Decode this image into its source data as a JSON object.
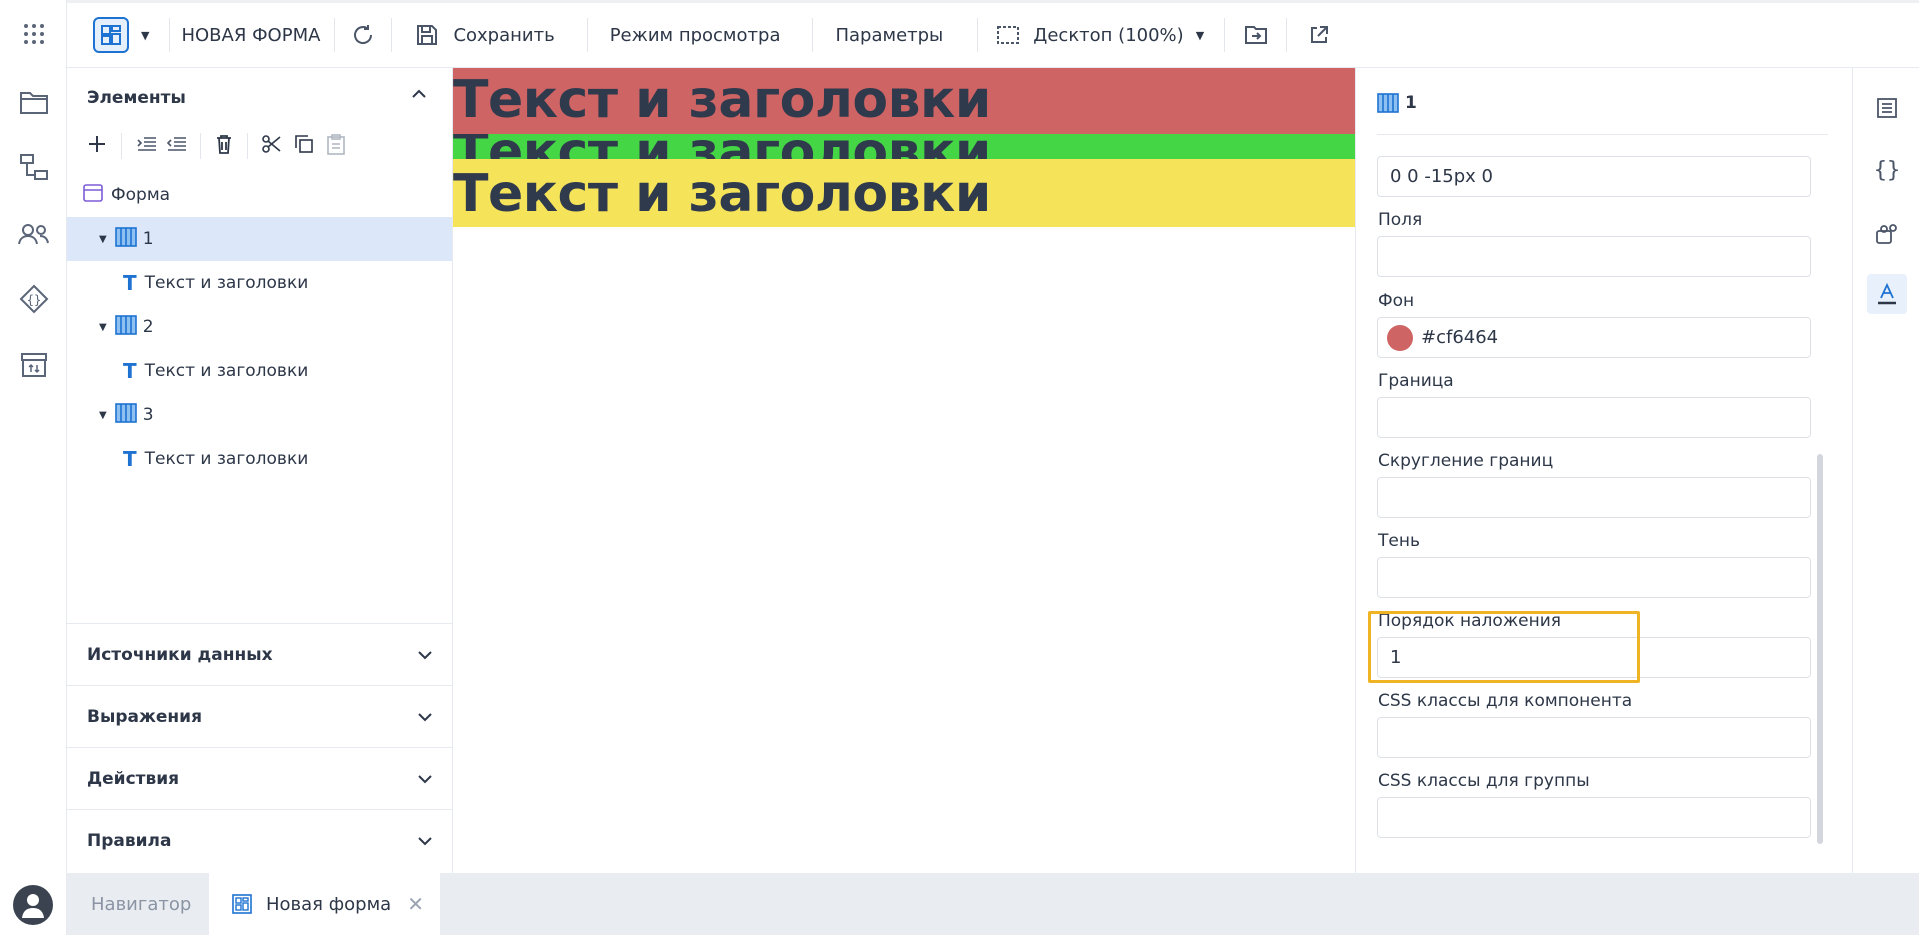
{
  "topbar": {
    "form_title": "НОВАЯ ФОРМА",
    "save_label": "Сохранить",
    "preview_label": "Режим просмотра",
    "params_label": "Параметры",
    "device_label": "Десктоп (100%)"
  },
  "left_panel": {
    "elements_title": "Элементы",
    "tree": [
      {
        "label": "Форма",
        "type": "form"
      },
      {
        "label": "1",
        "type": "columns",
        "selected": true
      },
      {
        "label": "Текст и заголовки",
        "type": "text"
      },
      {
        "label": "2",
        "type": "columns"
      },
      {
        "label": "Текст и заголовки",
        "type": "text"
      },
      {
        "label": "3",
        "type": "columns"
      },
      {
        "label": "Текст и заголовки",
        "type": "text"
      }
    ],
    "sections": [
      "Источники данных",
      "Выражения",
      "Действия",
      "Правила"
    ]
  },
  "canvas": {
    "bands": [
      {
        "text": "Текст и заголовки",
        "color": "#cf6464"
      },
      {
        "text": "Текст и заголовки",
        "color": "#44d644"
      },
      {
        "text": "Текст и заголовки",
        "color": "#f5e35a"
      }
    ]
  },
  "props": {
    "header_label": "1",
    "margin_value": "0 0 -15px 0",
    "padding_label": "Поля",
    "padding_value": "",
    "bg_label": "Фон",
    "bg_value": "#cf6464",
    "bg_color": "#cf6464",
    "border_label": "Граница",
    "border_value": "",
    "radius_label": "Скругление границ",
    "radius_value": "",
    "shadow_label": "Тень",
    "shadow_value": "",
    "zindex_label": "Порядок наложения",
    "zindex_value": "1",
    "css_comp_label": "CSS классы для компонента",
    "css_comp_value": "",
    "css_group_label": "CSS классы для группы",
    "css_group_value": ""
  },
  "bottom_tabs": {
    "navigator": "Навигатор",
    "active": "Новая форма"
  },
  "colors": {
    "accent": "#1e73d2",
    "highlight": "#f0b323",
    "selected_row": "#dce8f9"
  }
}
